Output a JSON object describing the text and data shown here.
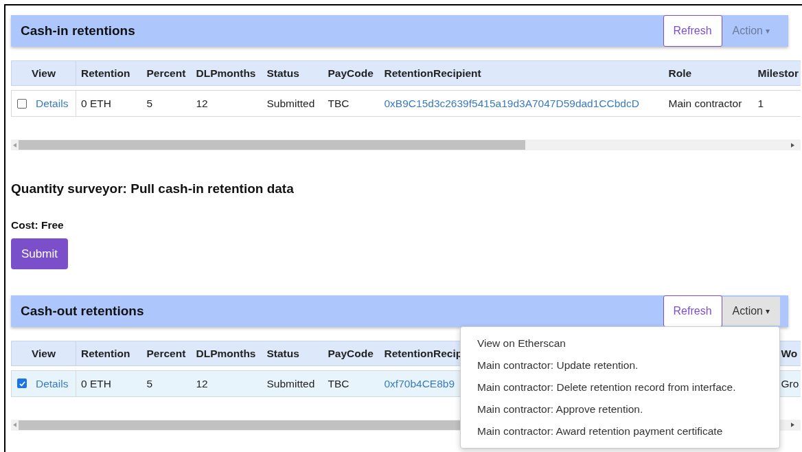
{
  "sections": [
    {
      "title": "Cash-in retentions",
      "refresh": "Refresh",
      "action": {
        "label": "Action",
        "caret": "▾",
        "expanded": false
      },
      "columns": [
        "View",
        "Retention",
        "Percent",
        "DLPmonths",
        "Status",
        "PayCode",
        "RetentionRecipient",
        "Role",
        "Milestor"
      ],
      "rows": [
        {
          "checked": false,
          "cells": [
            {
              "kind": "link",
              "text": "Details"
            },
            {
              "kind": "text",
              "text": "0 ETH"
            },
            {
              "kind": "text",
              "text": "5"
            },
            {
              "kind": "text",
              "text": "12"
            },
            {
              "kind": "text",
              "text": "Submitted"
            },
            {
              "kind": "text",
              "text": "TBC"
            },
            {
              "kind": "link",
              "text": "0xB9C15d3c2639f5415a19d3A7047D59dad1CCbdcD"
            },
            {
              "kind": "text",
              "text": "Main contractor"
            },
            {
              "kind": "text",
              "text": "1"
            }
          ]
        }
      ]
    },
    {
      "title": "Cash-out retentions",
      "refresh": "Refresh",
      "action": {
        "label": "Action",
        "caret": "▾",
        "expanded": true,
        "menu": [
          "View on Etherscan",
          "Main contractor: Update retention.",
          "Main contractor: Delete retention record from interface.",
          "Main contractor: Approve retention.",
          "Main contractor: Award retention payment certificate"
        ]
      },
      "columns": [
        "View",
        "Retention",
        "Percent",
        "DLPmonths",
        "Status",
        "PayCode",
        "RetentionRecip",
        "Wo"
      ],
      "rows": [
        {
          "checked": true,
          "cells": [
            {
              "kind": "link",
              "text": "Details"
            },
            {
              "kind": "text",
              "text": "0 ETH"
            },
            {
              "kind": "text",
              "text": "5"
            },
            {
              "kind": "text",
              "text": "12"
            },
            {
              "kind": "text",
              "text": "Submitted"
            },
            {
              "kind": "text",
              "text": "TBC"
            },
            {
              "kind": "link",
              "text": "0xf70b4CE8b9"
            },
            {
              "kind": "text",
              "text": "Gro"
            }
          ]
        }
      ]
    }
  ],
  "form": {
    "heading": "Quantity surveyor: Pull cash-in retention data",
    "cost": "Cost: Free",
    "submit": "Submit"
  }
}
